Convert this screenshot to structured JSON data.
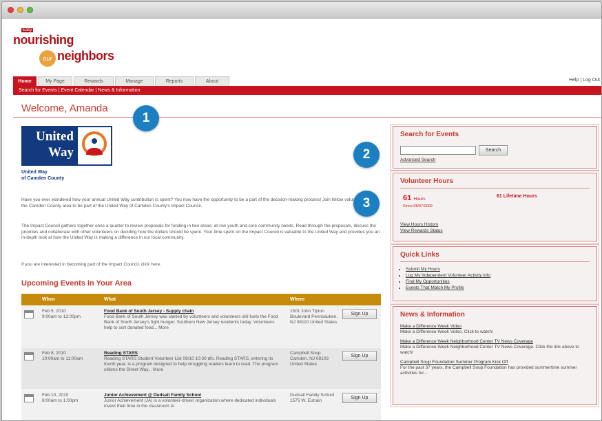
{
  "brand": {
    "small_tag": "Easy",
    "line1": "nourishing",
    "our": "our",
    "line2": "neighbors"
  },
  "nav": {
    "tabs": [
      "Home",
      "My Page",
      "Rewards",
      "Manage",
      "Reports",
      "About"
    ],
    "help_links": "Help | Log Out",
    "subnav": "Search for Events  |  Event Calendar  |  News & Information"
  },
  "welcome": "Welcome, Amanda",
  "badges": [
    "1",
    "2",
    "3"
  ],
  "united_way": {
    "logo_text": "United Way",
    "sub_line1": "United Way",
    "sub_line2": "of Camden County"
  },
  "paragraphs": {
    "p1": "Have you ever wondered how your annual United Way contribution is spent? You now have the opportunity to be a part of the decision-making process! Join fellow volunteers from the Camden County area to be part of the United Way of Camden County's Impact Council.",
    "p2": "The Impact Council gathers together once a quarter to review proposals for funding in two areas: at-risk youth and core community needs. Read through the proposals, discuss the priorities and collaborate with other volunteers on deciding how the dollars should be spent. Your time spent on the Impact Council is valuable to the United Way and provides you an in-depth look at how the United Way is making a difference in our local community.",
    "p3": "If you are interested in becoming part of the Impact Council, click here."
  },
  "events": {
    "title": "Upcoming Events in Your Area",
    "columns": [
      "When",
      "What",
      "Where"
    ],
    "signup_label": "Sign Up",
    "rows": [
      {
        "date": "Feb 5, 2010",
        "time": "9:00am to 12:00pm",
        "name": "Food Bank of South Jersey - Supply chain",
        "desc": "Food Bank of South Jersey was started by volunteers and volunteers still fuels the Food Bank of South Jersey's fight hunger. Southern New Jersey residents today. Volunteers help to sort donated food... More",
        "where": "1501 John Tipton Boulevard Pennsauken, NJ 08110 United States"
      },
      {
        "date": "Feb 8, 2010",
        "time": "10:00am to 11:00am",
        "name": "Reading STARS",
        "desc": "Reading STARS Student Volunteer List 09/10 10:30 dfs. Reading STARS, entering its fourth year, is a program designed to help struggling readers learn to read. The program utilizes the Street Way... More",
        "where": "Campbell Soup Camden, NJ 08103 United States"
      },
      {
        "date": "Feb 10, 2010",
        "time": "8:00am to 1:00pm",
        "name": "Junior Achievement @ Dudsall Family School",
        "desc": "Junior Achievement (JA) is a volunteer-driven organization where dedicated individuals invest their time in the classroom to",
        "where": "Dudsall Family School 1575 W. Eutrain"
      }
    ]
  },
  "sidebar": {
    "search": {
      "title": "Search for Events",
      "button": "Search",
      "advanced": "Advanced Search"
    },
    "hours": {
      "title": "Volunteer Hours",
      "current_value": "61",
      "current_unit": "Hours",
      "current_sub": "Since 08/07/2009",
      "lifetime": "61 Lifetime Hours",
      "links": [
        "View Hours History",
        "View Rewards Status"
      ]
    },
    "quick_links": {
      "title": "Quick Links",
      "items": [
        "Submit My Hours",
        "Log My Independent Volunteer Activity Info",
        "Find My Opportunities",
        "Events That Match My Profile"
      ]
    },
    "news": {
      "title": "News & Information",
      "items": [
        {
          "link": "Make a Difference Week Video",
          "text": "Make a Difference Week Video. Click to watch!"
        },
        {
          "link": "Make a Difference Week Neighborhood Center TV News Coverage",
          "text": "Make a Difference Week Neighborhood Center TV News Coverage. Click the link above to watch!"
        },
        {
          "link": "Campbell Soup Foundation Summer Program Kick Off",
          "text": "For the past 37 years, the Campbell Soup Foundation has provided summertime summer activities for..."
        }
      ]
    }
  }
}
